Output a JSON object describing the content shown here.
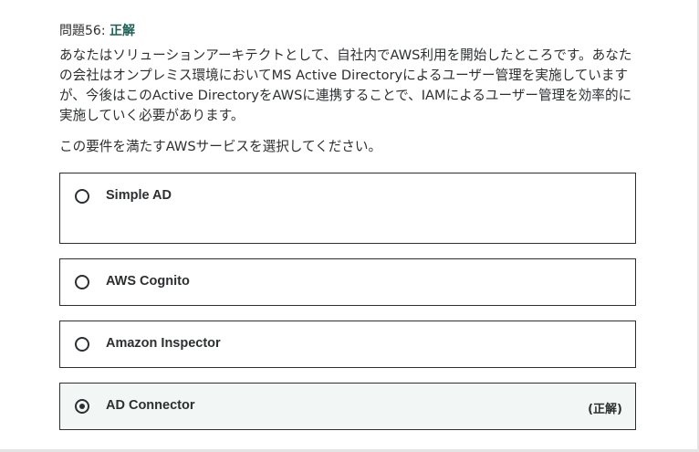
{
  "question": {
    "number_label": "問題56:",
    "result_label": "正解",
    "body": "あなたはソリューションアーキテクトとして、自社内でAWS利用を開始したところです。あなたの会社はオンプレミス環境においてMS Active Directoryによるユーザー管理を実施していますが、今後はこのActive DirectoryをAWSに連携することで、IAMによるユーザー管理を効率的に実施していく必要があります。",
    "prompt": "この要件を満たすAWSサービスを選択してください。"
  },
  "options": [
    {
      "label": "Simple AD",
      "selected": false,
      "tag": ""
    },
    {
      "label": "AWS Cognito",
      "selected": false,
      "tag": ""
    },
    {
      "label": "Amazon Inspector",
      "selected": false,
      "tag": ""
    },
    {
      "label": "AD Connector",
      "selected": true,
      "tag": "(正解)"
    }
  ],
  "colors": {
    "correct_accent": "#1e6055",
    "text": "#2d2f31",
    "selected_bg": "#f2f7f5"
  }
}
